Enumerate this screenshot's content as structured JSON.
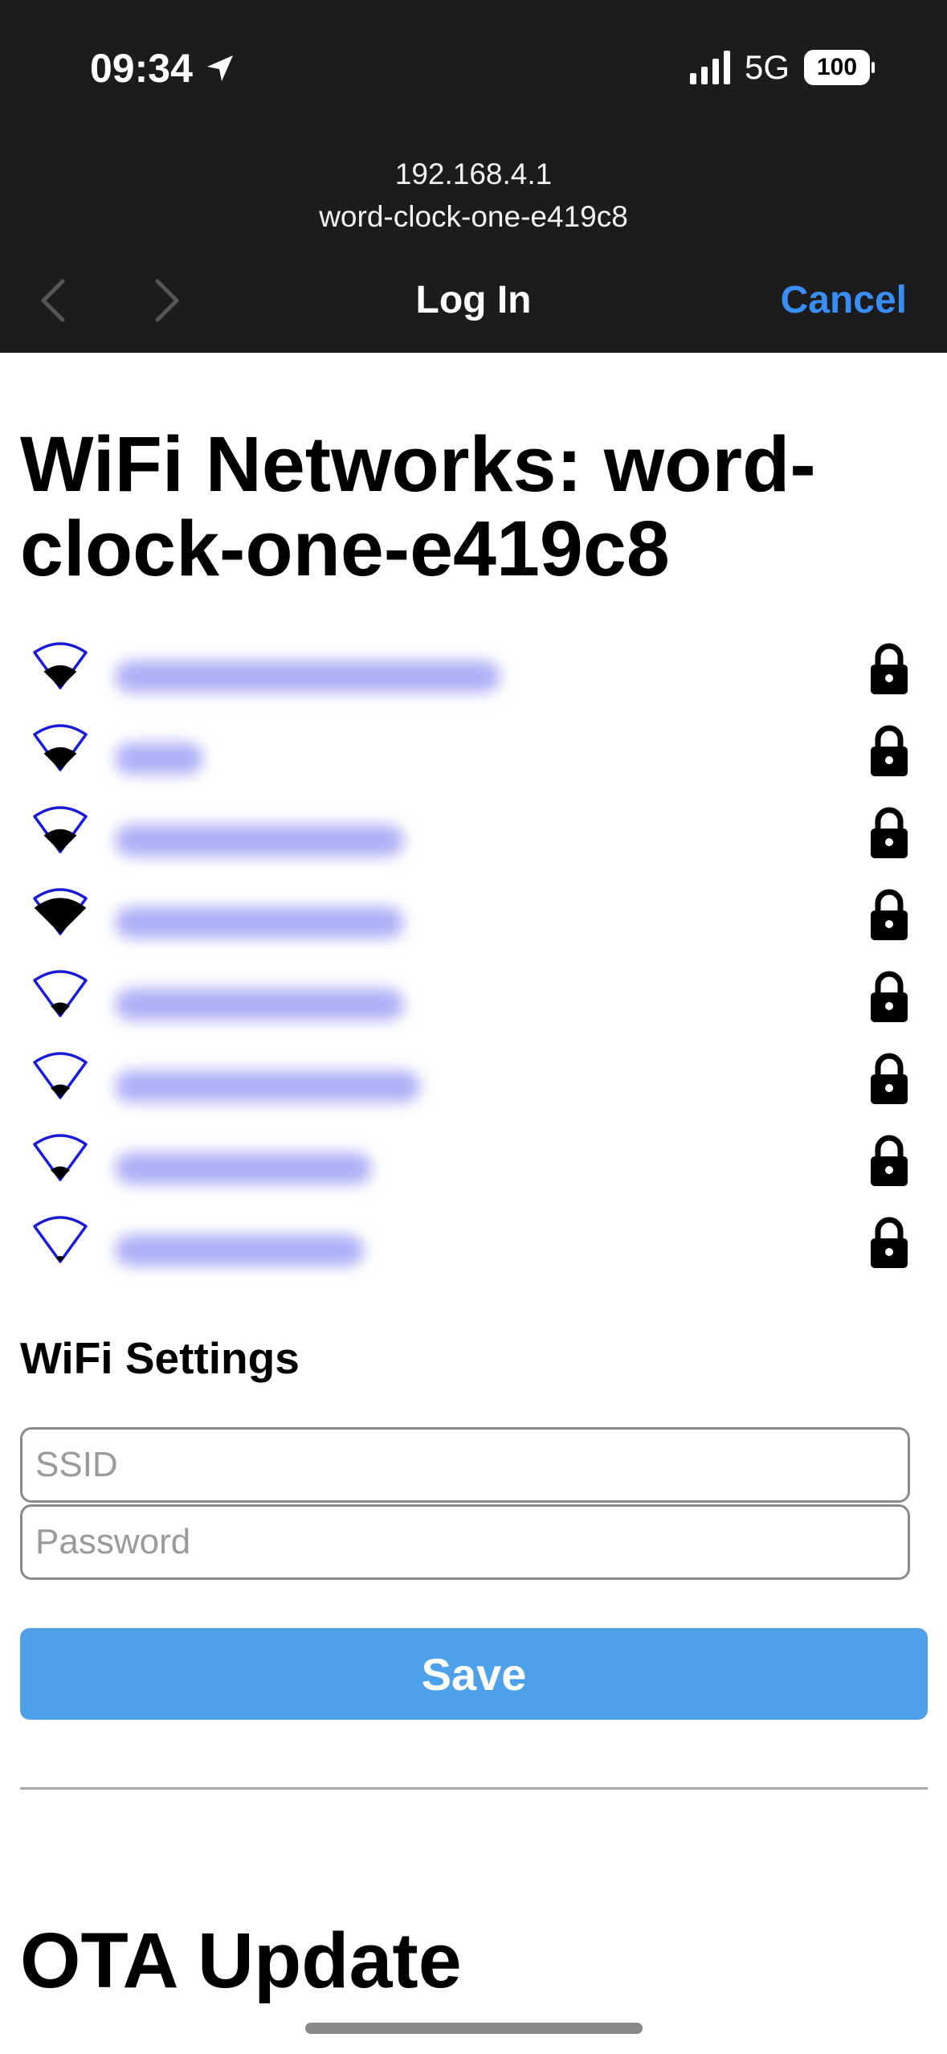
{
  "status_bar": {
    "time": "09:34",
    "network": "5G",
    "battery": "100"
  },
  "browser": {
    "url_host": "192.168.4.1",
    "url_subtitle": "word-clock-one-e419c8",
    "title": "Log In",
    "cancel_label": "Cancel"
  },
  "page": {
    "heading": "WiFi Networks: word-clock-one-e419c8",
    "networks": [
      {
        "ssid": "████████████████",
        "signal": 2,
        "locked": true
      },
      {
        "ssid": "████",
        "signal": 2,
        "locked": true
      },
      {
        "ssid": "███████████",
        "signal": 2,
        "locked": true
      },
      {
        "ssid": "███████████",
        "signal": 3,
        "locked": true
      },
      {
        "ssid": "███████████",
        "signal": 1,
        "locked": true
      },
      {
        "ssid": "████████████",
        "signal": 1,
        "locked": true
      },
      {
        "ssid": "██████████",
        "signal": 1,
        "locked": true
      },
      {
        "ssid": "██████████",
        "signal": 0,
        "locked": true
      }
    ],
    "settings_heading": "WiFi Settings",
    "ssid_placeholder": "SSID",
    "password_placeholder": "Password",
    "save_label": "Save",
    "ota_heading": "OTA Update"
  },
  "colors": {
    "accent": "#3a8df5",
    "save_button": "#4ea1e8",
    "wifi_outline": "#1a1ad6",
    "blurred_ssid": "#6e6ef0"
  }
}
